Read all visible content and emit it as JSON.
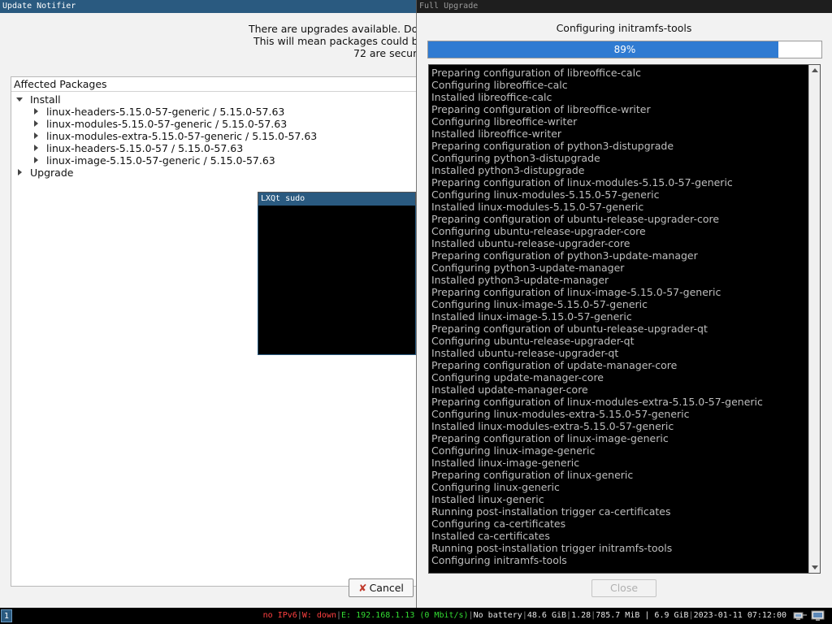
{
  "update_notifier": {
    "title": "Update Notifier",
    "message_lines": [
      "There are upgrades available. Do",
      "This will mean packages could be",
      "72 are secur"
    ],
    "tree_header": "Affected Packages",
    "install_label": "Install",
    "packages": [
      "linux-headers-5.15.0-57-generic  /  5.15.0-57.63",
      "linux-modules-5.15.0-57-generic  /  5.15.0-57.63",
      "linux-modules-extra-5.15.0-57-generic  /  5.15.0-57.63",
      "linux-headers-5.15.0-57  /  5.15.0-57.63",
      "linux-image-5.15.0-57-generic  /  5.15.0-57.63"
    ],
    "upgrade_label": "Upgrade",
    "cancel_label": "Cancel"
  },
  "sudo_window": {
    "title": "LXQt sudo"
  },
  "full_upgrade": {
    "title": "Full Upgrade",
    "status": "Configuring initramfs-tools",
    "progress_percent": 89,
    "progress_label": "89%",
    "log": [
      "Preparing configuration of libreoffice-calc",
      "Configuring libreoffice-calc",
      "Installed libreoffice-calc",
      "Preparing configuration of libreoffice-writer",
      "Configuring libreoffice-writer",
      "Installed libreoffice-writer",
      "Preparing configuration of python3-distupgrade",
      "Configuring python3-distupgrade",
      "Installed python3-distupgrade",
      "Preparing configuration of linux-modules-5.15.0-57-generic",
      "Configuring linux-modules-5.15.0-57-generic",
      "Installed linux-modules-5.15.0-57-generic",
      "Preparing configuration of ubuntu-release-upgrader-core",
      "Configuring ubuntu-release-upgrader-core",
      "Installed ubuntu-release-upgrader-core",
      "Preparing configuration of python3-update-manager",
      "Configuring python3-update-manager",
      "Installed python3-update-manager",
      "Preparing configuration of linux-image-5.15.0-57-generic",
      "Configuring linux-image-5.15.0-57-generic",
      "Installed linux-image-5.15.0-57-generic",
      "Preparing configuration of ubuntu-release-upgrader-qt",
      "Configuring ubuntu-release-upgrader-qt",
      "Installed ubuntu-release-upgrader-qt",
      "Preparing configuration of update-manager-core",
      "Configuring update-manager-core",
      "Installed update-manager-core",
      "Preparing configuration of linux-modules-extra-5.15.0-57-generic",
      "Configuring linux-modules-extra-5.15.0-57-generic",
      "Installed linux-modules-extra-5.15.0-57-generic",
      "Preparing configuration of linux-image-generic",
      "Configuring linux-image-generic",
      "Installed linux-image-generic",
      "Preparing configuration of linux-generic",
      "Configuring linux-generic",
      "Installed linux-generic",
      "Running post-installation trigger ca-certificates",
      "Configuring ca-certificates",
      "Installed ca-certificates",
      "Running post-installation trigger initramfs-tools",
      "Configuring initramfs-tools"
    ],
    "close_label": "Close"
  },
  "taskbar": {
    "workspace": "1",
    "ipv6": "no IPv6",
    "wireless": "W: down",
    "ethernet": "E: 192.168.1.13 (0 Mbit/s)",
    "battery": "No battery",
    "disk": "48.6 GiB",
    "load": "1.28",
    "memory": "785.7 MiB | 6.9 GiB",
    "datetime": "2023-01-11 07:12:00",
    "tray_icons": [
      "network-icon",
      "display-icon"
    ]
  }
}
